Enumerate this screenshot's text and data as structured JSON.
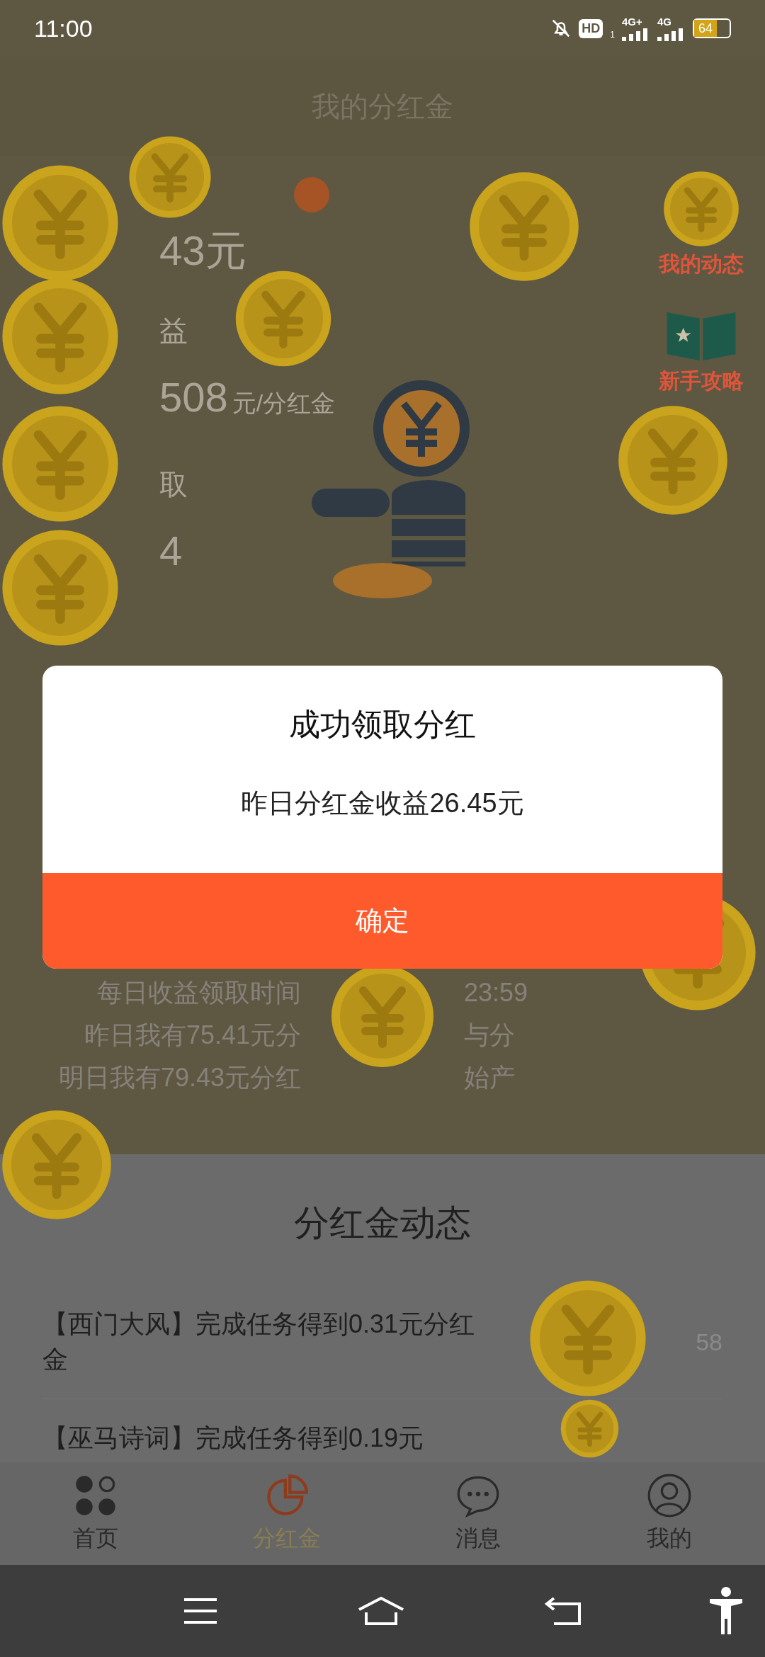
{
  "status_bar": {
    "time": "11:00",
    "hd": "HD",
    "sim": "1",
    "network_1": "4G+",
    "network_2": "4G",
    "battery": "64"
  },
  "header": {
    "title": "我的分红金"
  },
  "stats": [
    {
      "text": "43元"
    },
    {
      "text": "益"
    },
    {
      "text": "508",
      "unit": "元/分红金"
    },
    {
      "text": "取"
    },
    {
      "text": "4"
    }
  ],
  "side_links": [
    {
      "kind": "coin",
      "label": "我的动态"
    },
    {
      "kind": "book",
      "label": "新手攻略"
    }
  ],
  "info_lines": [
    {
      "left": "每日收益领取时间",
      "right": "23:59"
    },
    {
      "left": "昨日我有75.41元分",
      "right": "与分"
    },
    {
      "left": "明日我有79.43元分红",
      "right": "始产"
    }
  ],
  "dialog": {
    "title": "成功领取分红",
    "message": "昨日分红金收益26.45元",
    "button": "确定"
  },
  "feed": {
    "title": "分红金动态",
    "items": [
      {
        "text": "【西门大风】完成任务得到0.31元分红金",
        "time": "58"
      },
      {
        "text": "【巫马诗词】完成任务得到0.19元"
      }
    ]
  },
  "tabs": [
    {
      "kind": "home",
      "label": "首页",
      "selected": false
    },
    {
      "kind": "pie",
      "label": "分红金",
      "selected": true
    },
    {
      "kind": "chat",
      "label": "消息",
      "selected": false
    },
    {
      "kind": "user",
      "label": "我的",
      "selected": false
    }
  ]
}
